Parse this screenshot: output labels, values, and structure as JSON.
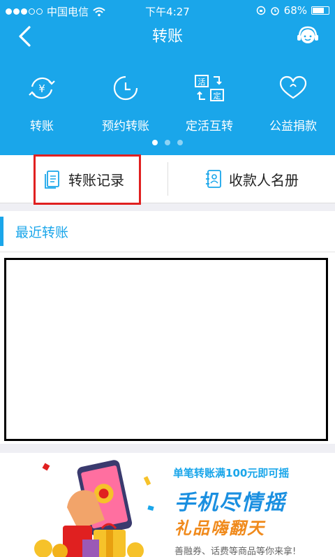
{
  "status_bar": {
    "carrier": "中国电信",
    "time": "下午4:27",
    "battery": "68%"
  },
  "nav": {
    "title": "转账"
  },
  "quick_actions": [
    {
      "label": "转账",
      "icon": "yen-exchange-icon"
    },
    {
      "label": "预约转账",
      "icon": "clock-icon"
    },
    {
      "label": "定活互转",
      "icon": "swap-huo-ding-icon"
    },
    {
      "label": "公益捐款",
      "icon": "heart-icon"
    }
  ],
  "quick_icon_text": {
    "yen": "¥",
    "huo": "活",
    "ding": "定"
  },
  "pager": {
    "count": 3,
    "active": 0
  },
  "tabs": {
    "records": "转账记录",
    "payees": "收款人名册"
  },
  "section": {
    "title": "最近转账"
  },
  "banner": {
    "line1": "单笔转账满100元即可摇",
    "line2": "手机尽情摇",
    "line3": "礼品嗨翻天",
    "line4": "善融券、话费等商品等你来拿!"
  },
  "colors": {
    "brand": "#1aa6ea",
    "highlight": "#e02020"
  }
}
